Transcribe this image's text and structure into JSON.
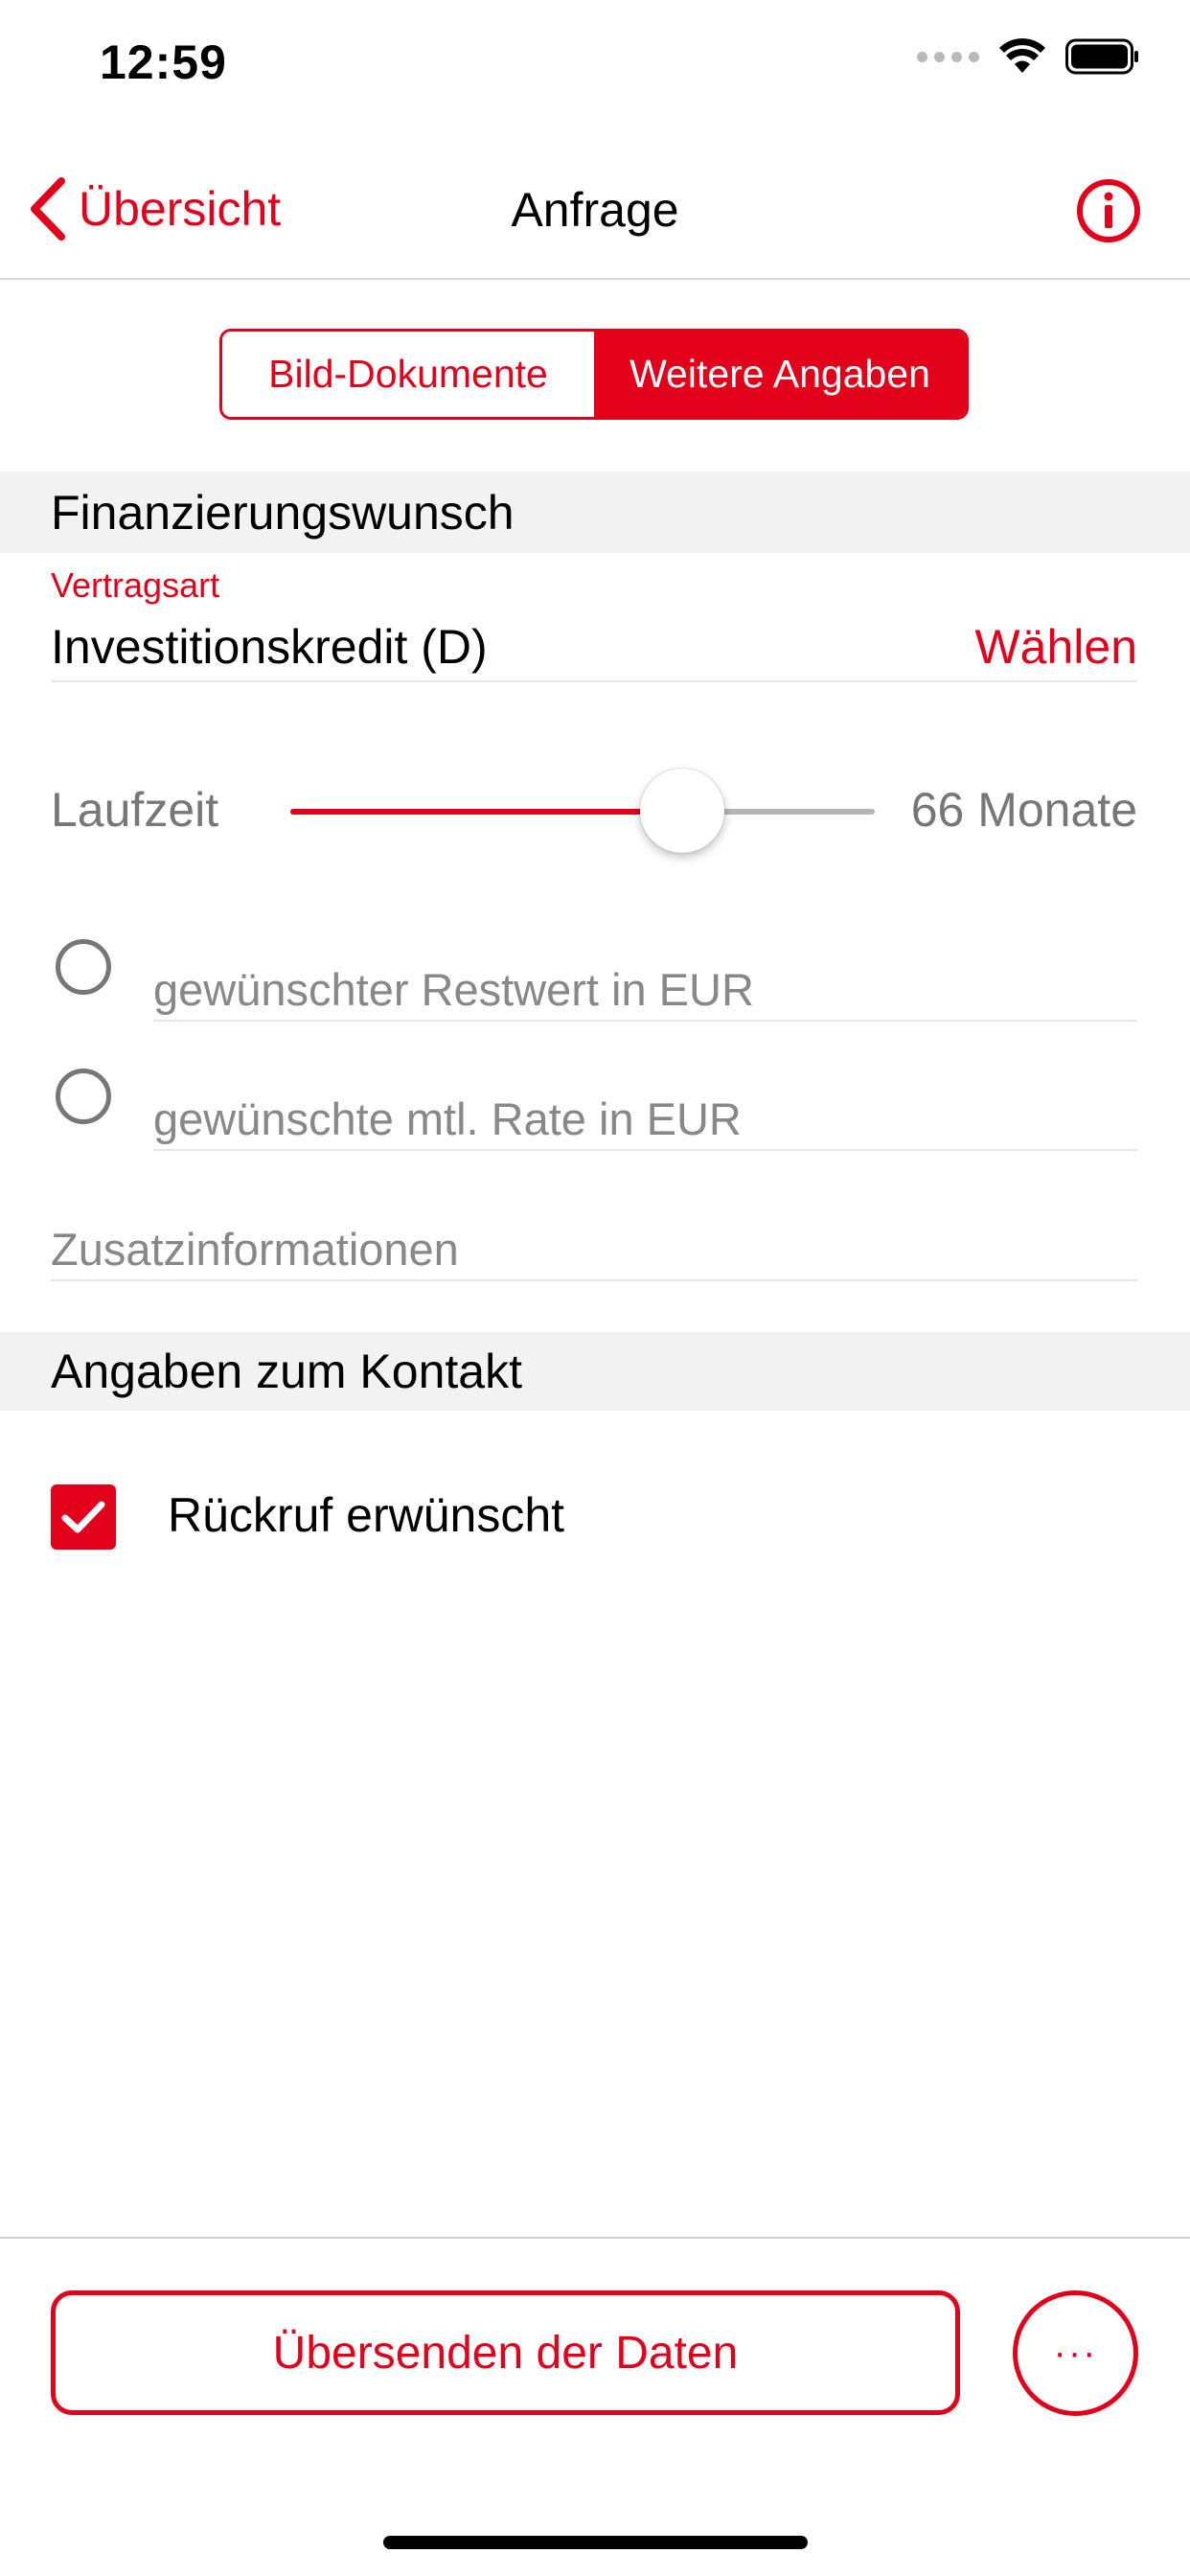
{
  "status_bar": {
    "time": "12:59"
  },
  "nav": {
    "back_label": "Übersicht",
    "title": "Anfrage",
    "info_icon": "info-circle-icon"
  },
  "segmented": {
    "tabs": [
      {
        "label": "Bild-Dokumente",
        "active": false
      },
      {
        "label": "Weitere Angaben",
        "active": true
      }
    ]
  },
  "sections": {
    "financing": "Finanzierungswunsch",
    "contact": "Angaben zum Kontakt"
  },
  "contract": {
    "label": "Vertragsart",
    "value": "Investitionskredit (D)",
    "choose_label": "Wählen"
  },
  "duration": {
    "label": "Laufzeit",
    "value_label": "66 Monate",
    "fraction": 0.67
  },
  "options": {
    "residual_value_placeholder": "gewünschter Restwert in EUR",
    "monthly_rate_placeholder": "gewünschte mtl. Rate in EUR"
  },
  "additional_info_placeholder": "Zusatzinformationen",
  "callback": {
    "label": "Rückruf erwünscht",
    "checked": true
  },
  "footer": {
    "submit_label": "Übersenden der Daten",
    "more_label": "···"
  },
  "colors": {
    "accent": "#e2001a",
    "section_bg": "#f2f2f2"
  }
}
